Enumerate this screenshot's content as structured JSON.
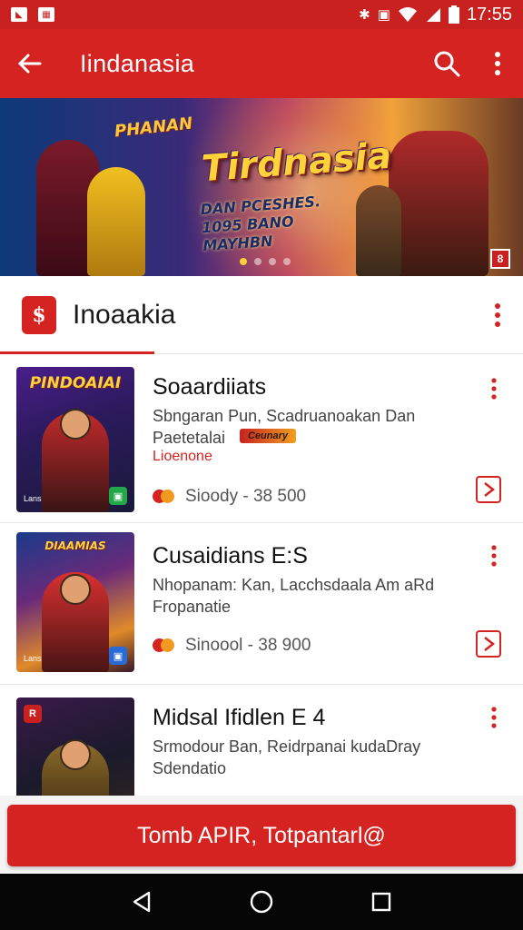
{
  "status_bar": {
    "time": "17:55",
    "icons": [
      "bluetooth-icon",
      "vibrate-icon",
      "wifi-icon",
      "signal-icon",
      "battery-icon"
    ]
  },
  "app_bar": {
    "title": "Iindanasia",
    "icons": [
      "back-arrow-icon",
      "search-icon",
      "more-vert-icon"
    ]
  },
  "banner": {
    "title": "Tirdnasia",
    "subtitle": "DAN PCESHES. 1095 BANO MAYHBN",
    "corner_text": "PHANAN",
    "page_count": 4,
    "active_page": 1,
    "badge": "8"
  },
  "section": {
    "title": "Inoaakia",
    "icon": "store-bag-icon"
  },
  "apps": [
    {
      "title": "Soaardiiats",
      "desc": "Sbngaran Pun, Scadruanoakan Dan Paetetalai",
      "tag_badge": "Ceunary",
      "tag": "Lioenone",
      "price": "Sioody - 38 500",
      "thumb_title": "PINDOAIAI",
      "thumb_tag": "Lans",
      "thumb_badge_color": "#22a84a"
    },
    {
      "title": "Cusaidians E:S",
      "desc": "Nhopanam: Kan, Lacchsdaala Am aRd Fropanatie",
      "tag": "",
      "price": "Sinoool - 38 900",
      "thumb_title": "DIAAMIAS",
      "thumb_tag": "Lans",
      "thumb_badge_color": "#2a6ad8"
    },
    {
      "title": "Midsal Ifidlen E 4",
      "desc": "Srmodour Ban, Reidrpanai kudaDray Sdendatio",
      "tag": "",
      "price": "",
      "thumb_title": "",
      "thumb_tag": "",
      "thumb_badge_color": "#c8211f"
    }
  ],
  "cta": {
    "label": "Tomb APIR, Totpantarl@"
  },
  "nav_bar": {
    "icons": [
      "back-triangle-icon",
      "home-circle-icon",
      "recents-square-icon"
    ]
  },
  "colors": {
    "brand_red": "#d42320",
    "status_red": "#c8211f",
    "nav_black": "#050505"
  }
}
